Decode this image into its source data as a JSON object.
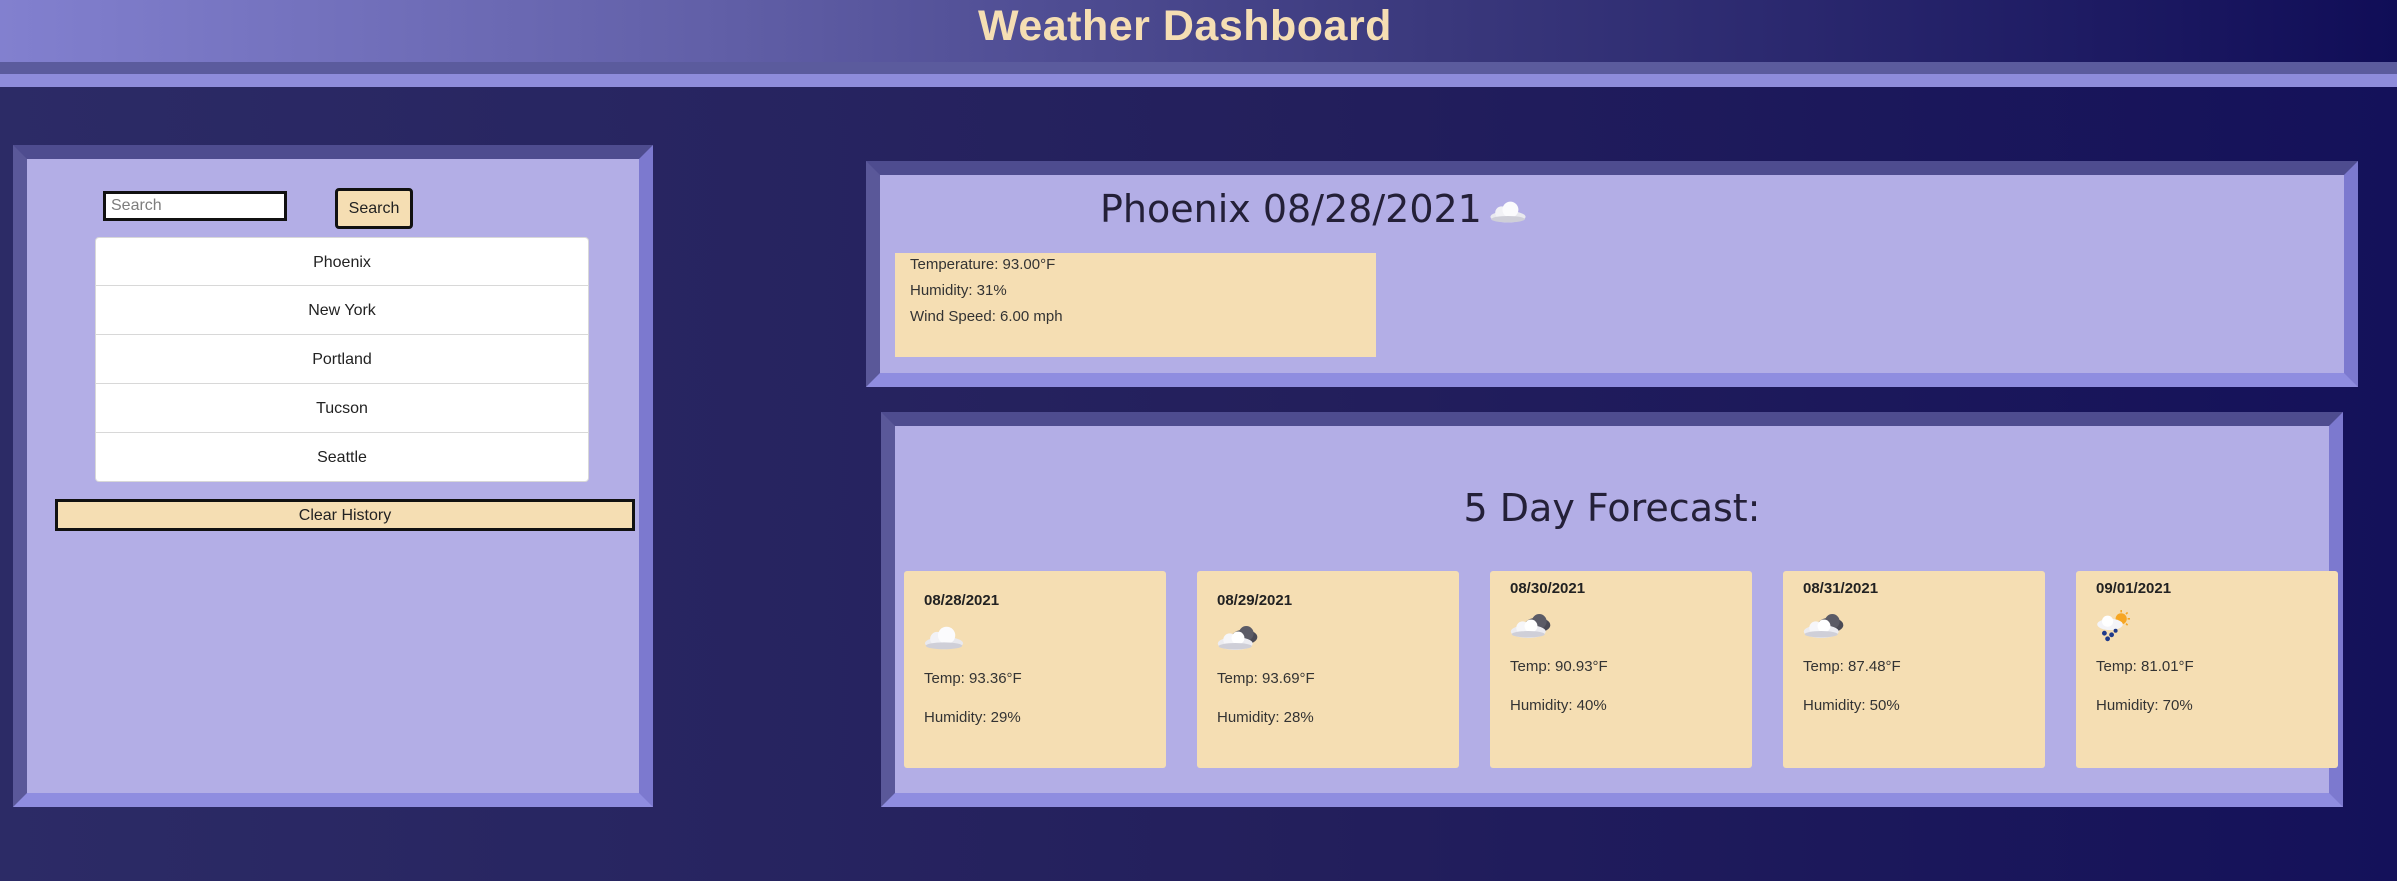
{
  "header": {
    "title": "Weather Dashboard"
  },
  "colors": {
    "panel_bg": "#b3aee6",
    "accent": "#f5deb3",
    "page_bg": "#231f5c",
    "header_bg": "#615fa7"
  },
  "search": {
    "placeholder": "Search",
    "value": "",
    "button_label": "Search"
  },
  "history": [
    "Phoenix",
    "New York",
    "Portland",
    "Tucson",
    "Seattle"
  ],
  "clear_label": "Clear History",
  "current": {
    "title": "Phoenix 08/28/2021",
    "icon": "cloud-icon",
    "temperature": "Temperature: 93.00°F",
    "humidity": "Humidity: 31%",
    "wind": "Wind Speed: 6.00 mph"
  },
  "forecast": {
    "title": "5 Day Forecast:",
    "days": [
      {
        "date": "08/28/2021",
        "icon": "cloud-icon",
        "temp": "Temp: 93.36°F",
        "humidity": "Humidity: 29%"
      },
      {
        "date": "08/29/2021",
        "icon": "dark-cloud-icon",
        "temp": "Temp: 93.69°F",
        "humidity": "Humidity: 28%"
      },
      {
        "date": "08/30/2021",
        "icon": "dark-cloud-icon",
        "temp": "Temp: 90.93°F",
        "humidity": "Humidity: 40%"
      },
      {
        "date": "08/31/2021",
        "icon": "dark-cloud-icon",
        "temp": "Temp: 87.48°F",
        "humidity": "Humidity: 50%"
      },
      {
        "date": "09/01/2021",
        "icon": "sun-rain-icon",
        "temp": "Temp: 81.01°F",
        "humidity": "Humidity: 70%"
      }
    ]
  }
}
